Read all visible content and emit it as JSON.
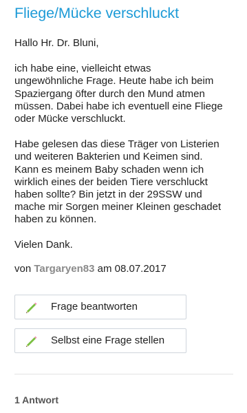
{
  "question": {
    "title": "Fliege/Mücke verschluckt",
    "greeting": "Hallo Hr. Dr. Bluni,",
    "paragraph1_lines": [
      "ich habe eine, vielleicht etwas",
      "ungewöhnliche Frage. Heute habe ich beim",
      "Spaziergang öfter durch den Mund atmen",
      "müssen. Dabei habe ich eventuell eine Fliege",
      "oder Mücke verschluckt."
    ],
    "paragraph2_lines": [
      "Habe gelesen das diese Träger von Listerien",
      "und weiteren Bakterien und Keimen sind.",
      "Kann es meinem Baby schaden wenn ich",
      "wirklich eines der beiden Tiere verschluckt",
      "haben sollte? Bin jetzt in der 29SSW und",
      "mache mir Sorgen meiner Kleinen geschadet",
      "haben zu können."
    ],
    "thanks": "Vielen Dank.",
    "meta": {
      "prefix": "von",
      "author": "Targaryen83",
      "date_text": "am 08.07.2017"
    }
  },
  "actions": {
    "answer_label": "Frage beantworten",
    "ask_label": "Selbst eine Frage stellen",
    "icon": "pencil-icon"
  },
  "answers": {
    "count_label": "1 Antwort"
  },
  "colors": {
    "title": "#1e9bd7",
    "author": "#8a8a8a",
    "pencil_body": "#7bc043"
  }
}
